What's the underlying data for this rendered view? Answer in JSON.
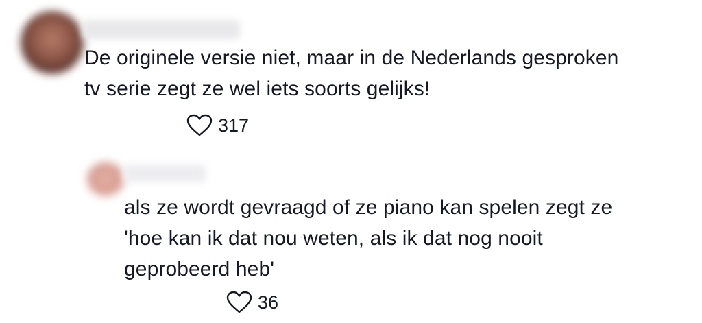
{
  "comments": [
    {
      "text_lines": [
        "De originele versie niet, maar in de Nederlands gesproken",
        "tv serie zegt ze wel iets soorts gelijks!"
      ],
      "like_count": "317",
      "icon": "heart-outline-icon"
    },
    {
      "text_lines": [
        "als ze wordt gevraagd of ze piano kan spelen zegt ze",
        "'hoe kan ik dat nou weten, als ik dat nog nooit",
        "geprobeerd heb'"
      ],
      "like_count": "36",
      "icon": "heart-outline-icon"
    }
  ],
  "colors": {
    "text": "#161823",
    "background": "#ffffff",
    "icon_stroke": "#161823"
  }
}
